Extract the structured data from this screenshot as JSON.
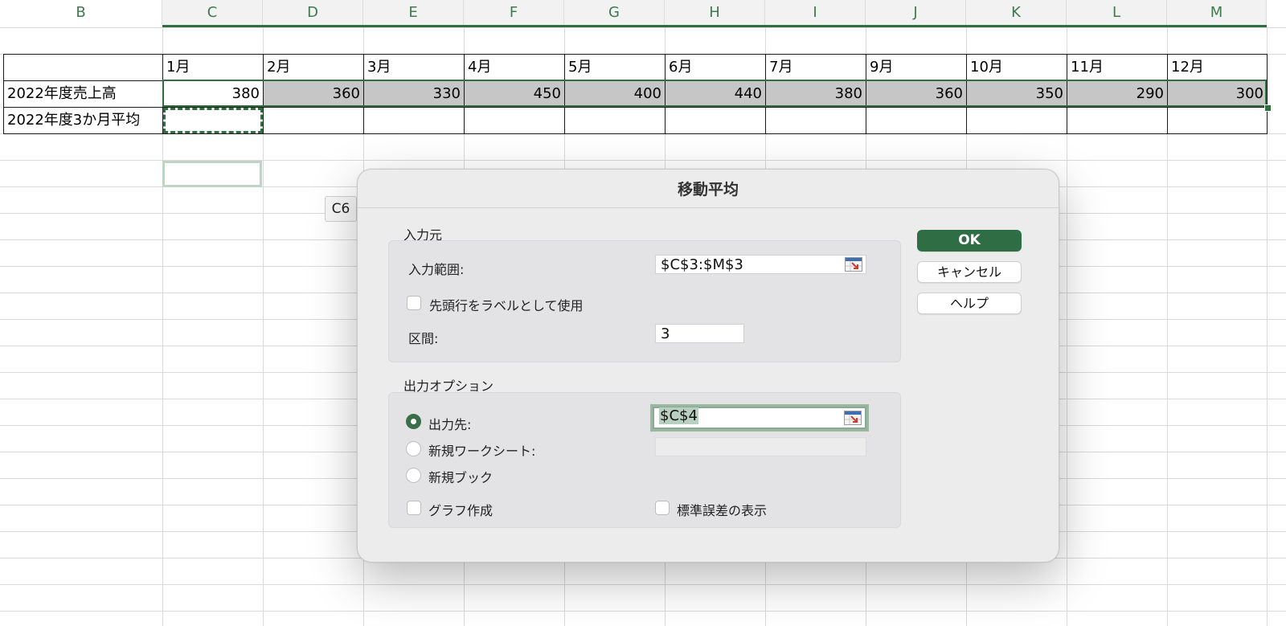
{
  "spreadsheet": {
    "column_headers": [
      "B",
      "C",
      "D",
      "E",
      "F",
      "G",
      "H",
      "I",
      "J",
      "K",
      "L",
      "M"
    ],
    "month_headers": [
      "1月",
      "2月",
      "3月",
      "4月",
      "5月",
      "6月",
      "7月",
      "9月",
      "10月",
      "11月",
      "12月"
    ],
    "row_sales_label": "2022年度売上高",
    "sales_values": [
      "380",
      "360",
      "330",
      "450",
      "400",
      "440",
      "380",
      "360",
      "350",
      "290",
      "300"
    ],
    "row_avg_label": "2022年度3か月平均",
    "selection_color": "#2f6e3f"
  },
  "tooltip": {
    "text": "C6"
  },
  "dialog": {
    "title": "移動平均",
    "input_group_title": "入力元",
    "input_range_label": "入力範囲:",
    "input_range_value": "$C$3:$M$3",
    "first_row_label_checkbox": "先頭行をラベルとして使用",
    "interval_label": "区間:",
    "interval_value": "3",
    "output_group_title": "出力オプション",
    "output_dest_label": "出力先:",
    "output_dest_value": "$C$4",
    "new_worksheet_label": "新規ワークシート:",
    "new_workbook_label": "新規ブック",
    "chart_output_label": "グラフ作成",
    "std_error_label": "標準誤差の表示",
    "ok_label": "OK",
    "cancel_label": "キャンセル",
    "help_label": "ヘルプ",
    "accent_color": "#2f6e45",
    "selected_output_option": "出力先:"
  }
}
